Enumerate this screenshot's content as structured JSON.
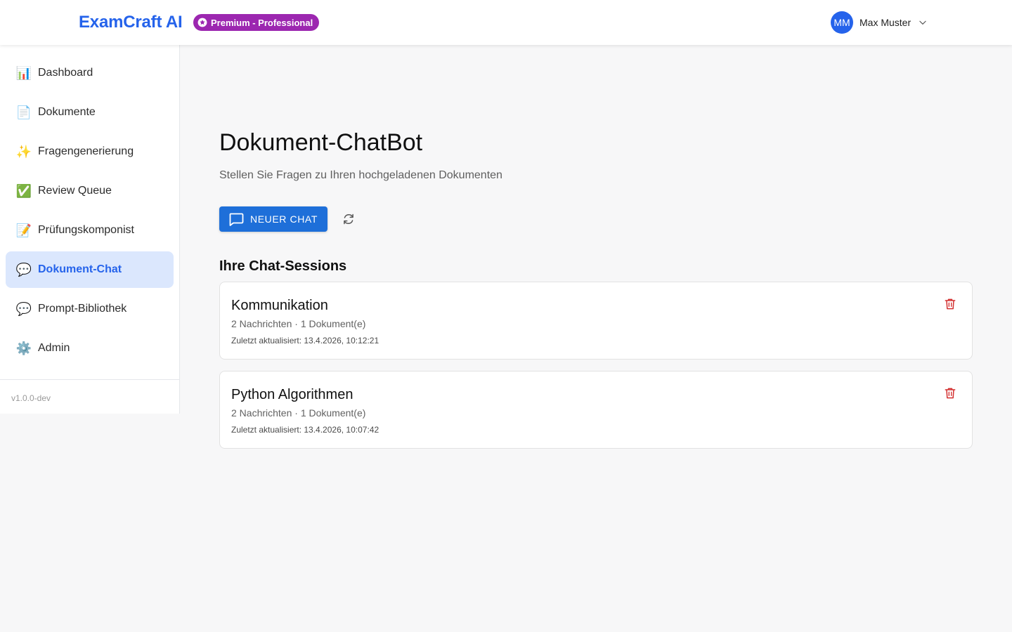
{
  "header": {
    "brand": "ExamCraft AI",
    "plan_badge": "Premium - Professional",
    "user": {
      "initials": "MM",
      "name": "Max Muster"
    }
  },
  "sidebar": {
    "items": [
      {
        "label": "Dashboard",
        "icon": "📊",
        "icon_name": "bar-chart-icon",
        "active": false
      },
      {
        "label": "Dokumente",
        "icon": "📄",
        "icon_name": "document-icon",
        "active": false
      },
      {
        "label": "Fragengenerierung",
        "icon": "✨",
        "icon_name": "sparkles-icon",
        "active": false
      },
      {
        "label": "Review Queue",
        "icon": "✅",
        "icon_name": "check-icon",
        "active": false
      },
      {
        "label": "Prüfungskomponist",
        "icon": "📝",
        "icon_name": "memo-icon",
        "active": false
      },
      {
        "label": "Dokument-Chat",
        "icon": "💬",
        "icon_name": "speech-bubble-icon",
        "active": true
      },
      {
        "label": "Prompt-Bibliothek",
        "icon": "💬",
        "icon_name": "speech-bubble-icon",
        "active": false
      },
      {
        "label": "Admin",
        "icon": "⚙️",
        "icon_name": "gear-icon",
        "active": false
      }
    ],
    "version": "v1.0.0-dev"
  },
  "main": {
    "title": "Dokument-ChatBot",
    "subtitle": "Stellen Sie Fragen zu Ihren hochgeladenen Dokumenten",
    "new_chat_label": "NEUER CHAT",
    "sessions_title": "Ihre Chat-Sessions",
    "sessions": [
      {
        "title": "Kommunikation",
        "meta": "2 Nachrichten · 1 Dokument(e)",
        "updated": "Zuletzt aktualisiert: 13.4.2026, 10:12:21"
      },
      {
        "title": "Python Algorithmen",
        "meta": "2 Nachrichten · 1 Dokument(e)",
        "updated": "Zuletzt aktualisiert: 13.4.2026, 10:07:42"
      }
    ]
  },
  "colors": {
    "brand": "#2563eb",
    "badge": "#9c27b0",
    "primary_button": "#1e6fd9",
    "active_nav_bg": "#dbe7fd",
    "delete": "#d32f2f"
  }
}
